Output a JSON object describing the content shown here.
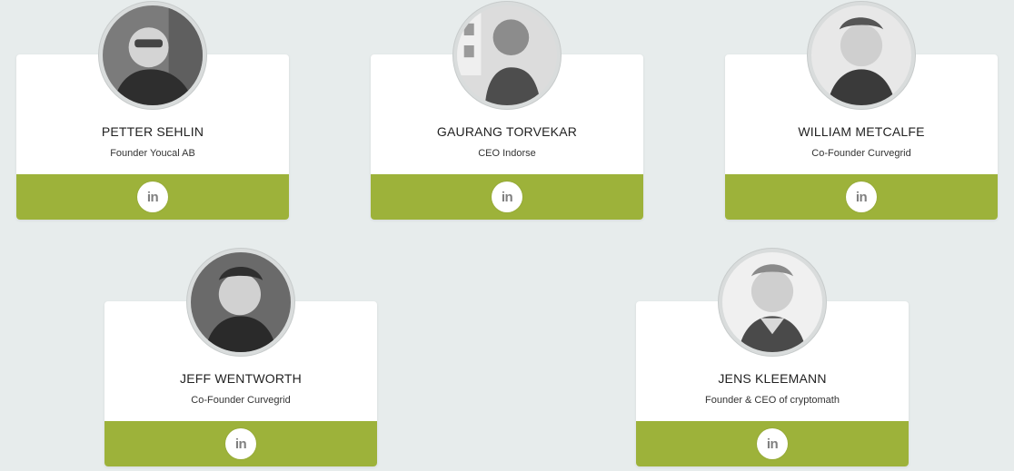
{
  "team": [
    {
      "name": "PETTER SEHLIN",
      "role": "Founder Youcal AB",
      "social_icon": "in",
      "photo": "photo"
    },
    {
      "name": "GAURANG TORVEKAR",
      "role": "CEO Indorse",
      "social_icon": "in",
      "photo": "photo"
    },
    {
      "name": "WILLIAM METCALFE",
      "role": "Co-Founder Curvegrid",
      "social_icon": "in",
      "photo": "photo"
    },
    {
      "name": "JEFF WENTWORTH",
      "role": "Co-Founder Curvegrid",
      "social_icon": "in",
      "photo": "photo"
    },
    {
      "name": "JENS KLEEMANN",
      "role": "Founder & CEO of cryptomath",
      "social_icon": "in",
      "photo": "photo"
    }
  ],
  "colors": {
    "background": "#e7ecec",
    "card": "#ffffff",
    "accent": "#9db23a",
    "text": "#222222",
    "icon": "#7f7f7f"
  }
}
